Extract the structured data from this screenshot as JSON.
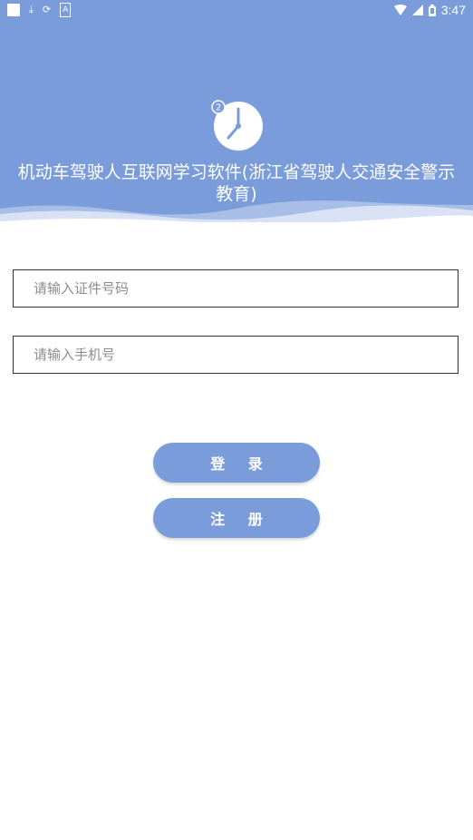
{
  "status_bar": {
    "time": "3:47",
    "left_icons": [
      "notification-square-icon",
      "download-icon",
      "sync-icon",
      "a-icon"
    ],
    "right_icons": [
      "wifi-icon",
      "signal-icon",
      "battery-icon"
    ]
  },
  "header": {
    "app_title": "机动车驾驶人互联网学习软件(浙江省驾驶人交通安全警示教育)",
    "logo_icon": "clock-icon",
    "clock_badge": "2",
    "bg_color": "#7b9cda"
  },
  "form": {
    "id_placeholder": "请输入证件号码",
    "phone_placeholder": "请输入手机号"
  },
  "buttons": {
    "login": "登 录",
    "register": "注 册"
  },
  "colors": {
    "accent": "#7b9cda",
    "input_border": "#333333",
    "placeholder": "#8d8d8d"
  }
}
